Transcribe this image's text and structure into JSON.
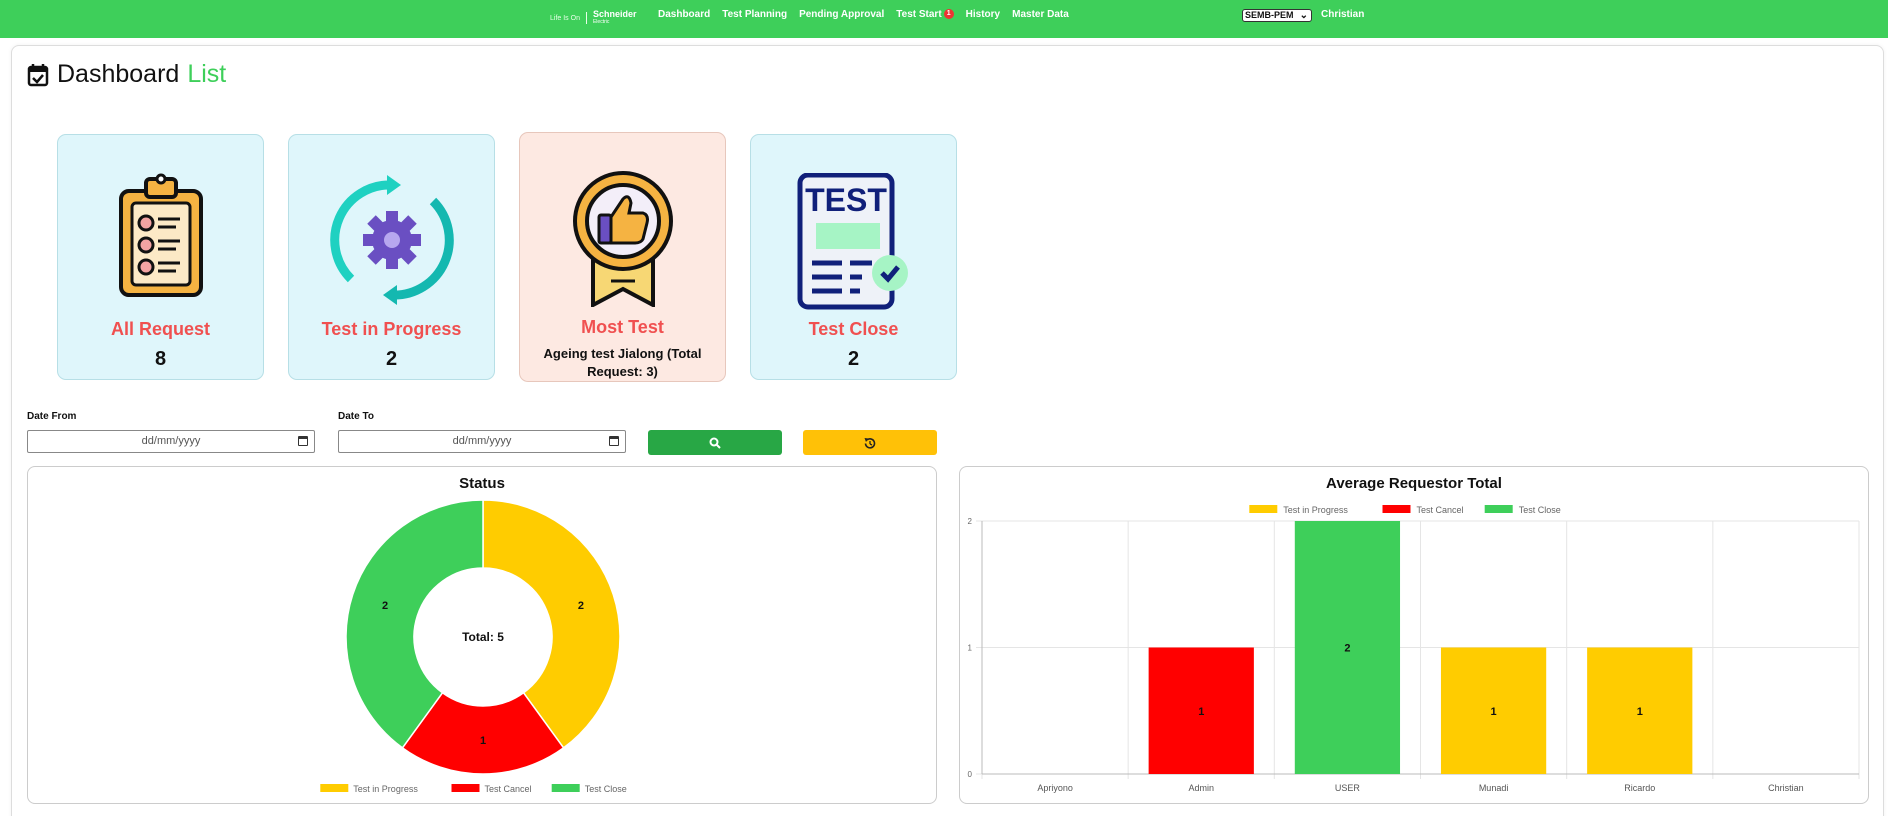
{
  "nav": {
    "brand_tagline": "Life Is On",
    "brand_name": "Schneider",
    "brand_sub": "Electric",
    "items": [
      {
        "label": "Dashboard"
      },
      {
        "label": "Test Planning"
      },
      {
        "label": "Pending Approval"
      },
      {
        "label": "Test Start",
        "badge": "1"
      },
      {
        "label": "History"
      },
      {
        "label": "Master Data"
      }
    ],
    "plant_select": "SEMB-PEM",
    "user": "Christian"
  },
  "page": {
    "title_main": "Dashboard",
    "title_accent": "List"
  },
  "cards": [
    {
      "label": "All Request",
      "value": "8",
      "icon": "clipboard-checklist-icon"
    },
    {
      "label": "Test in Progress",
      "value": "2",
      "icon": "gear-refresh-icon"
    },
    {
      "label": "Most Test",
      "value": "Ageing test Jialong (Total Request: 3)",
      "icon": "thumbs-up-medal-icon"
    },
    {
      "label": "Test Close",
      "value": "2",
      "icon": "test-document-icon"
    }
  ],
  "filters": {
    "date_from_label": "Date From",
    "date_to_label": "Date To",
    "date_from_placeholder": "dd/mm/yyyy",
    "date_to_placeholder": "dd/mm/yyyy",
    "search_icon": "search-icon",
    "reset_icon": "reset-icon"
  },
  "colors": {
    "progress": "#ffcc00",
    "cancel": "#ff0000",
    "close": "#3ecf5a",
    "navbar": "#3ecf5a"
  },
  "chart_data": [
    {
      "type": "pie",
      "title": "Status",
      "center_text": "Total: 5",
      "labels": [
        "Test in Progress",
        "Test Cancel",
        "Test Close"
      ],
      "values": [
        2,
        1,
        2
      ],
      "colors": [
        "#ffcc00",
        "#ff0000",
        "#3ecf5a"
      ],
      "legend": "bottom"
    },
    {
      "type": "bar",
      "title": "Average Requestor Total",
      "categories": [
        "Apriyono",
        "Admin",
        "USER",
        "Munadi",
        "Ricardo",
        "Christian"
      ],
      "series": [
        {
          "name": "Test in Progress",
          "color": "#ffcc00",
          "values": [
            0,
            0,
            0,
            1,
            1,
            0
          ]
        },
        {
          "name": "Test Cancel",
          "color": "#ff0000",
          "values": [
            0,
            1,
            0,
            0,
            0,
            0
          ]
        },
        {
          "name": "Test Close",
          "color": "#3ecf5a",
          "values": [
            0,
            0,
            2,
            0,
            0,
            0
          ]
        }
      ],
      "ylim": [
        0,
        2
      ],
      "yticks": [
        0,
        1,
        2
      ],
      "grid": true,
      "legend": "top"
    }
  ]
}
